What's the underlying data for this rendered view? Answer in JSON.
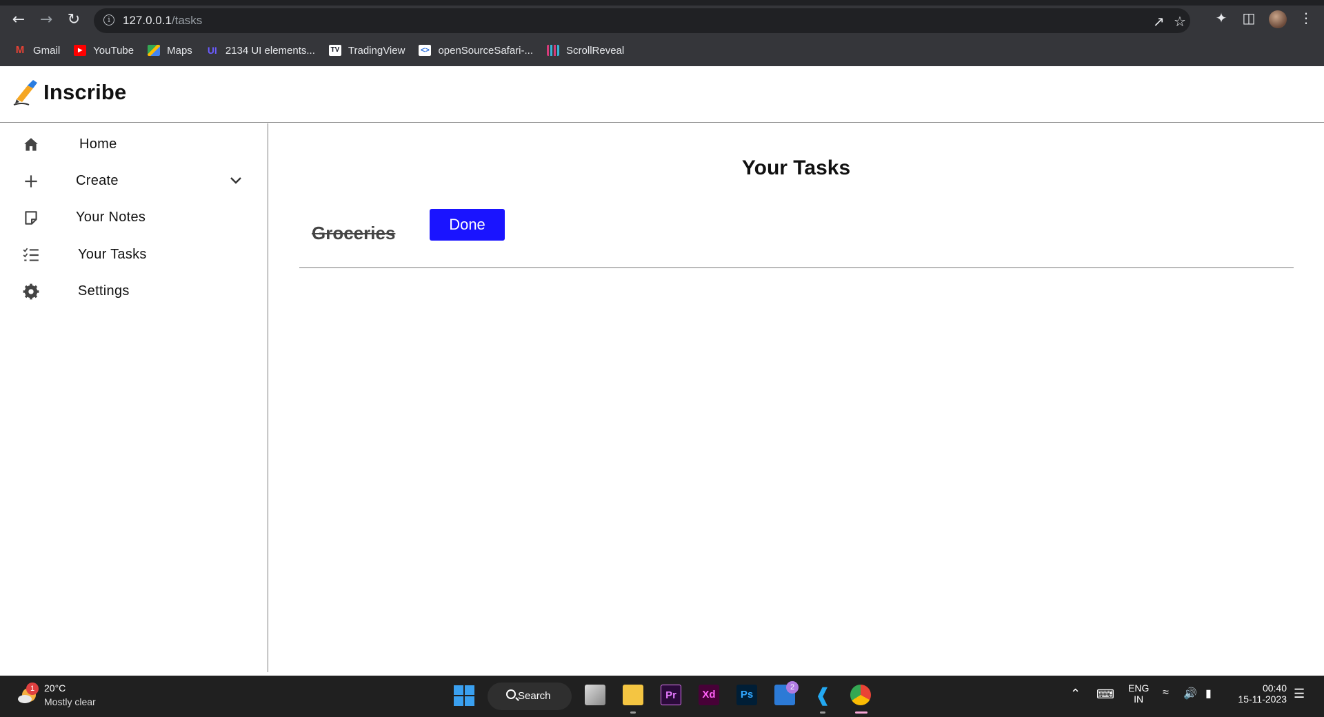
{
  "browser": {
    "url_host": "127.0.0.1",
    "url_path": "/tasks",
    "bookmarks": [
      {
        "label": "Gmail",
        "icon": "gmail-icon",
        "color": "#ea4335"
      },
      {
        "label": "YouTube",
        "icon": "youtube-icon",
        "color": "#ff0000"
      },
      {
        "label": "Maps",
        "icon": "maps-icon",
        "color": "#34a853"
      },
      {
        "label": "2134 UI elements...",
        "icon": "uiverse-icon",
        "color": "#6b5cff"
      },
      {
        "label": "TradingView",
        "icon": "tradingview-icon",
        "color": "#131722"
      },
      {
        "label": "openSourceSafari-...",
        "icon": "opensourcesafari-icon",
        "color": "#ffffff"
      },
      {
        "label": "ScrollReveal",
        "icon": "scrollreveal-icon",
        "color": "#d63b7a"
      }
    ]
  },
  "app": {
    "name": "Inscribe"
  },
  "sidebar": {
    "items": [
      {
        "label": "Home",
        "icon": "home-icon"
      },
      {
        "label": "Create",
        "icon": "plus-icon"
      },
      {
        "label": "Your Notes",
        "icon": "note-icon"
      },
      {
        "label": "Your Tasks",
        "icon": "tasklist-icon"
      },
      {
        "label": "Settings",
        "icon": "gear-icon"
      }
    ]
  },
  "main": {
    "title": "Your Tasks",
    "tasks": [
      {
        "name": "Groceries",
        "completed": true,
        "action_label": "Done"
      }
    ]
  },
  "taskbar": {
    "weather_badge": "1",
    "weather_temp": "20°C",
    "weather_desc": "Mostly clear",
    "search_label": "Search",
    "teams_badge": "2",
    "lang_line1": "ENG",
    "lang_line2": "IN",
    "time": "00:40",
    "date": "15-11-2023"
  },
  "colors": {
    "accent_button": "#1a14ff",
    "chrome_bg": "#35363a",
    "taskbar_bg": "#202020"
  }
}
